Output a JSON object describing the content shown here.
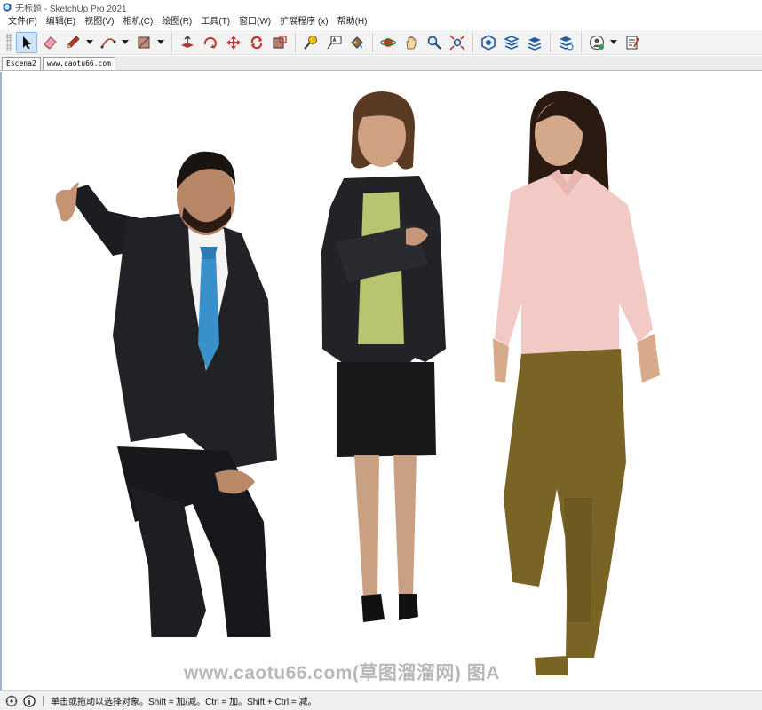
{
  "window": {
    "title": "无标题 - SketchUp Pro 2021"
  },
  "menu": [
    "文件(F)",
    "编辑(E)",
    "视图(V)",
    "相机(C)",
    "绘图(R)",
    "工具(T)",
    "窗口(W)",
    "扩展程序 (x)",
    "帮助(H)"
  ],
  "toolbar": {
    "groups": [
      [
        "select-icon",
        "eraser-icon",
        "line-pencil-icon",
        "arc-icon",
        "rectangle-icon"
      ],
      [
        "push-pull-icon",
        "rotate-icon",
        "move-icon",
        "follow-me-icon",
        "scale-icon"
      ],
      [
        "tape-measure-icon",
        "text-label-icon",
        "paint-bucket-icon"
      ],
      [
        "orbit-icon",
        "pan-icon",
        "zoom-icon",
        "zoom-extents-icon"
      ],
      [
        "warehouse-icon",
        "extension-warehouse-icon",
        "layout-icon",
        "extension-manager-icon"
      ],
      [
        "profile-icon",
        "report-icon"
      ]
    ],
    "accent": "#84b6e3"
  },
  "scene_tabs": [
    "Escena2",
    "www.caotu66.com"
  ],
  "viewport": {
    "watermark": "www.caotu66.com(草图溜溜网) 图A"
  },
  "status": {
    "message": "单击或拖动以选择对象。Shift = 加/减。Ctrl = 加。Shift + Ctrl = 减。"
  }
}
